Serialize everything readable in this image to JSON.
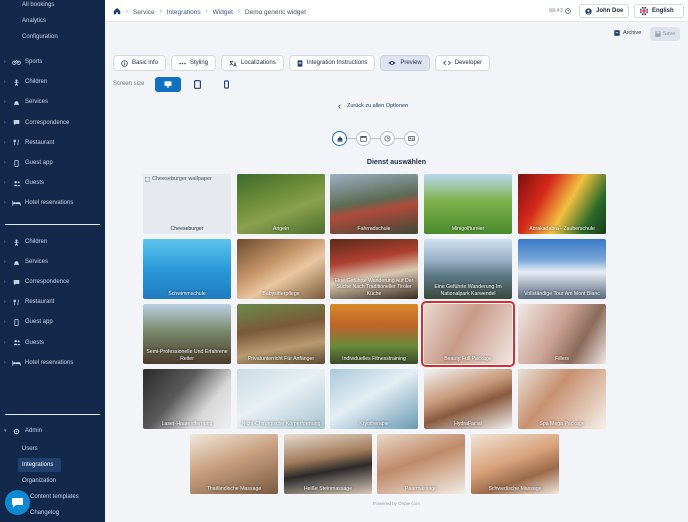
{
  "sidebar": {
    "top_subitems": [
      "All bookings",
      "Analytics",
      "Configuration"
    ],
    "group1": [
      {
        "label": "Sports",
        "icon": "bicycle-icon"
      },
      {
        "label": "Children",
        "icon": "child-icon"
      },
      {
        "label": "Services",
        "icon": "bell-icon"
      },
      {
        "label": "Correspondence",
        "icon": "chat-icon"
      },
      {
        "label": "Restaurant",
        "icon": "restaurant-icon"
      },
      {
        "label": "Guest app",
        "icon": "phone-icon"
      },
      {
        "label": "Guests",
        "icon": "guests-icon"
      },
      {
        "label": "Hotel reservations",
        "icon": "bed-icon"
      }
    ],
    "group2": [
      {
        "label": "Children",
        "icon": "child-icon"
      },
      {
        "label": "Services",
        "icon": "bell-icon"
      },
      {
        "label": "Correspondence",
        "icon": "chat-icon"
      },
      {
        "label": "Restaurant",
        "icon": "restaurant-icon"
      },
      {
        "label": "Guest app",
        "icon": "phone-icon"
      },
      {
        "label": "Guests",
        "icon": "guests-icon"
      },
      {
        "label": "Hotel reservations",
        "icon": "bed-icon"
      }
    ],
    "admin": {
      "label": "Admin",
      "items": [
        "Users",
        "Integrations",
        "Organization",
        "Content templates",
        "Changelog"
      ],
      "active": "Integrations"
    }
  },
  "breadcrumbs": [
    "Service",
    "Integrations",
    "Widget",
    "Demo generic widget"
  ],
  "topbar": {
    "time": "08:43",
    "user": "John Doe",
    "language": "English"
  },
  "actions": {
    "archive": "Archive",
    "save": "Save"
  },
  "tabs": [
    {
      "label": "Basic info",
      "icon": "info-icon"
    },
    {
      "label": "Styling",
      "icon": "more-icon"
    },
    {
      "label": "Localizations",
      "icon": "translate-icon"
    },
    {
      "label": "Integration Instructions",
      "icon": "document-icon"
    },
    {
      "label": "Preview",
      "icon": "eye-icon",
      "active": true
    },
    {
      "label": "Developer",
      "icon": "code-icon"
    }
  ],
  "screen_size": {
    "label": "Screen size",
    "options": [
      "desktop",
      "tablet",
      "mobile"
    ],
    "selected": "desktop"
  },
  "widget": {
    "back_link": "Zurück zu allen Optionen",
    "section_title": "Dienst auswählen",
    "broken_alt": "Cheeseburger wallpaper",
    "powered_by": "Powered by Onpie.com"
  },
  "services": [
    "Cheeseburger",
    "Angeln",
    "Fahrradschule",
    "Minigolfturnier",
    "Abrakadabra - Zauberschule",
    "Schwimmschule",
    "Babysitterpflege",
    "Eine Geführte Wanderung Auf Der Suche Nach Traditioneller Tiroler Küche",
    "Eine Geführte Wanderung Im Nationalpark Karwendel",
    "Vollständige Tour Am Mont Blanc",
    "Semi-Professionelle Und Erfahrene Reiter",
    "Privatunterricht Für Anfänger",
    "Individuelles Fitnesstraining",
    "Beauty Full Package",
    "Fillers",
    "Laser-Haarentfernung",
    "Nicht-Chirurgische Körperformung",
    "Kryotherapie",
    "HydraFacial",
    "Spa Mega Package",
    "Thailändische Massage",
    "Heiße Steinmassage",
    "Paarmassage",
    "Schwedische Massage"
  ],
  "selected_service": "Beauty Full Package"
}
